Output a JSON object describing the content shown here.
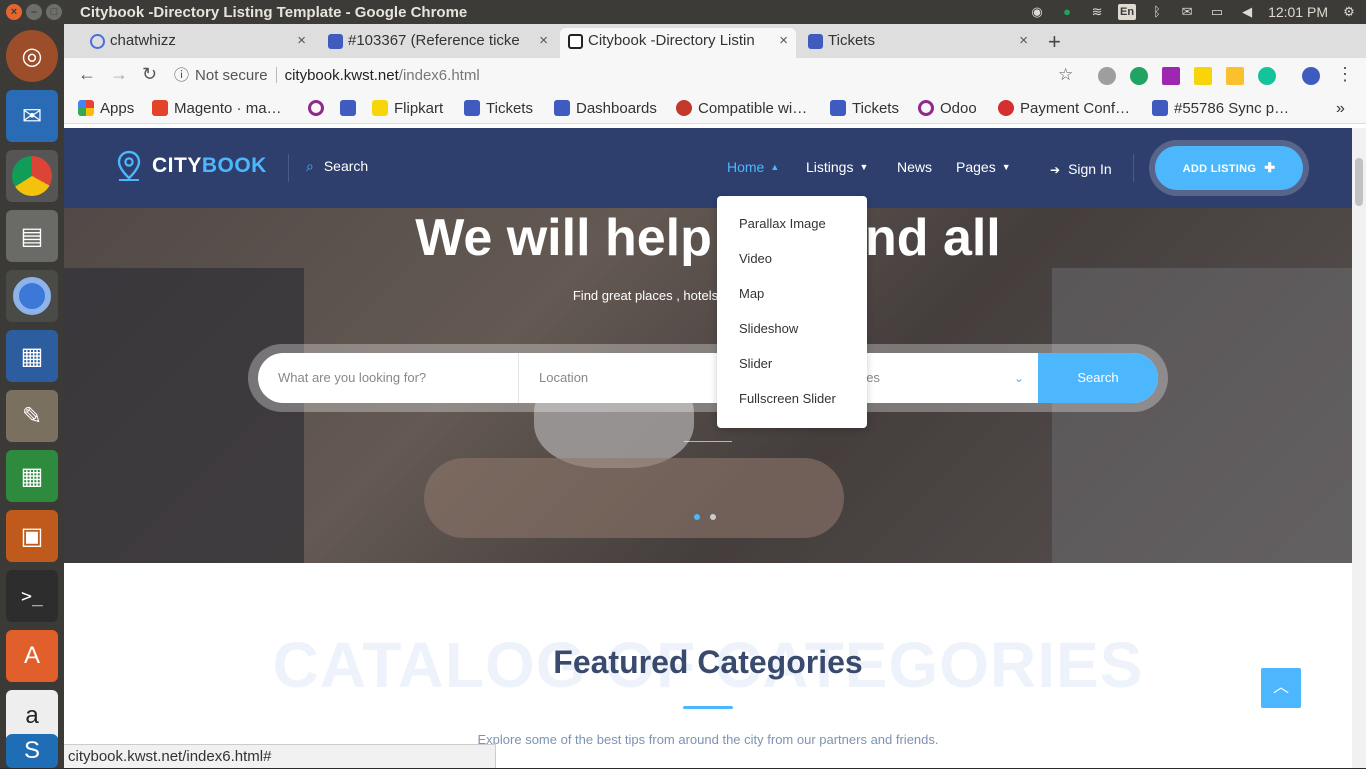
{
  "os": {
    "window_title": "Citybook -Directory Listing Template - Google Chrome",
    "lang": "En",
    "clock": "12:01 PM"
  },
  "browser": {
    "tabs": [
      {
        "label": "chatwhizz",
        "active": false
      },
      {
        "label": "#103367 (Reference ticke",
        "active": false
      },
      {
        "label": "Citybook -Directory Listin",
        "active": true
      },
      {
        "label": "Tickets",
        "active": false
      }
    ],
    "new_tab": "+",
    "security": "Not secure",
    "url_host": "citybook.kwst.net",
    "url_path": "/index6.html",
    "bookmarks": [
      {
        "label": "Apps",
        "color": "#e94235"
      },
      {
        "label": "Magento · ma…",
        "color": "#e24329"
      },
      {
        "label": "",
        "color": "#8e2a8b"
      },
      {
        "label": "",
        "color": "#3f5bbf"
      },
      {
        "label": "Flipkart",
        "color": "#f8d50b"
      },
      {
        "label": "Tickets",
        "color": "#3f5bbf"
      },
      {
        "label": "Dashboards",
        "color": "#3f5bbf"
      },
      {
        "label": "Compatible wi…",
        "color": "#c0392b"
      },
      {
        "label": "Tickets",
        "color": "#3f5bbf"
      },
      {
        "label": "Odoo",
        "color": "#8e2a8b"
      },
      {
        "label": "Payment Conf…",
        "color": "#d62f2f"
      },
      {
        "label": "#55786 Sync p…",
        "color": "#3f5bbf"
      }
    ],
    "more": "»",
    "status_url": "citybook.kwst.net/index6.html#"
  },
  "site": {
    "logo_main": "CITY",
    "logo_accent": "BOOK",
    "search_label": "Search",
    "nav": [
      {
        "label": "Home",
        "dropdown": true,
        "active": true
      },
      {
        "label": "Listings",
        "dropdown": true,
        "active": false
      },
      {
        "label": "News",
        "dropdown": false,
        "active": false
      },
      {
        "label": "Pages",
        "dropdown": true,
        "active": false
      }
    ],
    "sign_in": "Sign In",
    "add_listing": "ADD LISTING",
    "home_menu": [
      "Parallax Image",
      "Video",
      "Map",
      "Slideshow",
      "Slider",
      "Fullscreen Slider"
    ],
    "hero": {
      "title": "We will help you find all",
      "subtitle": "Find great places , hotels , restourants , shops.",
      "search": {
        "what_placeholder": "What are you looking for?",
        "location_placeholder": "Location",
        "category_placeholder": "All Categories",
        "button": "Search"
      }
    },
    "featured": {
      "bg_text": "CATALOG OF CATEGORIES",
      "title": "Featured Categories",
      "subtitle": "Explore some of the best tips from around the city from our partners and friends."
    },
    "colors": {
      "accent": "#4db7fe",
      "header": "#2e3f6e"
    }
  }
}
